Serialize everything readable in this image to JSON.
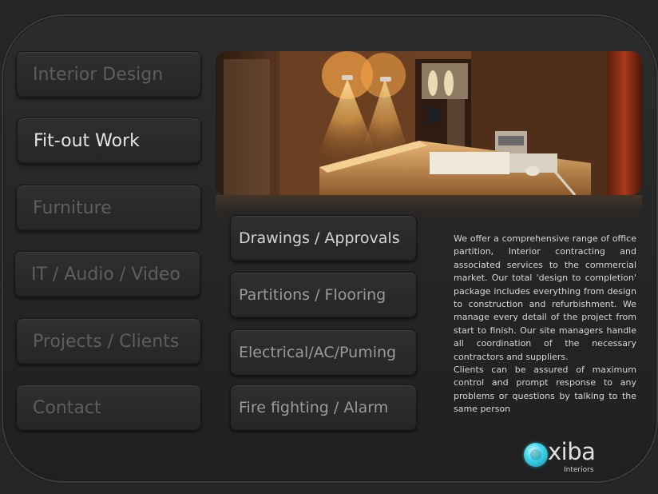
{
  "nav": {
    "items": [
      {
        "label": "Interior Design",
        "active": false
      },
      {
        "label": "Fit-out  Work",
        "active": true
      },
      {
        "label": "Furniture",
        "active": false
      },
      {
        "label": "IT / Audio / Video",
        "active": false
      },
      {
        "label": "Projects / Clients",
        "active": false
      },
      {
        "label": "Contact",
        "active": false
      }
    ]
  },
  "services": {
    "items": [
      {
        "label": "Drawings / Approvals"
      },
      {
        "label": "Partitions / Flooring"
      },
      {
        "label": "Electrical/AC/Puming"
      },
      {
        "label": "Fire fighting  / Alarm"
      }
    ]
  },
  "description": "We offer a comprehensive range of office partition, Interior contracting and associated services to the commercial market. Our total 'design to completion' package includes everything from design to construction and refurbishment. We manage every detail of the project from start to finish. Our site managers handle all coordination of the necessary contractors and suppliers.\nClients can be assured of maximum control and prompt response to any problems or questions by talking to the same person",
  "logo": {
    "word": "xiba",
    "subtitle": "Interiors",
    "accent": "#2ec6e0"
  },
  "colors": {
    "background": "#262626",
    "nav_text": "#5e5e5e",
    "nav_active_text": "#e6e6e6"
  }
}
